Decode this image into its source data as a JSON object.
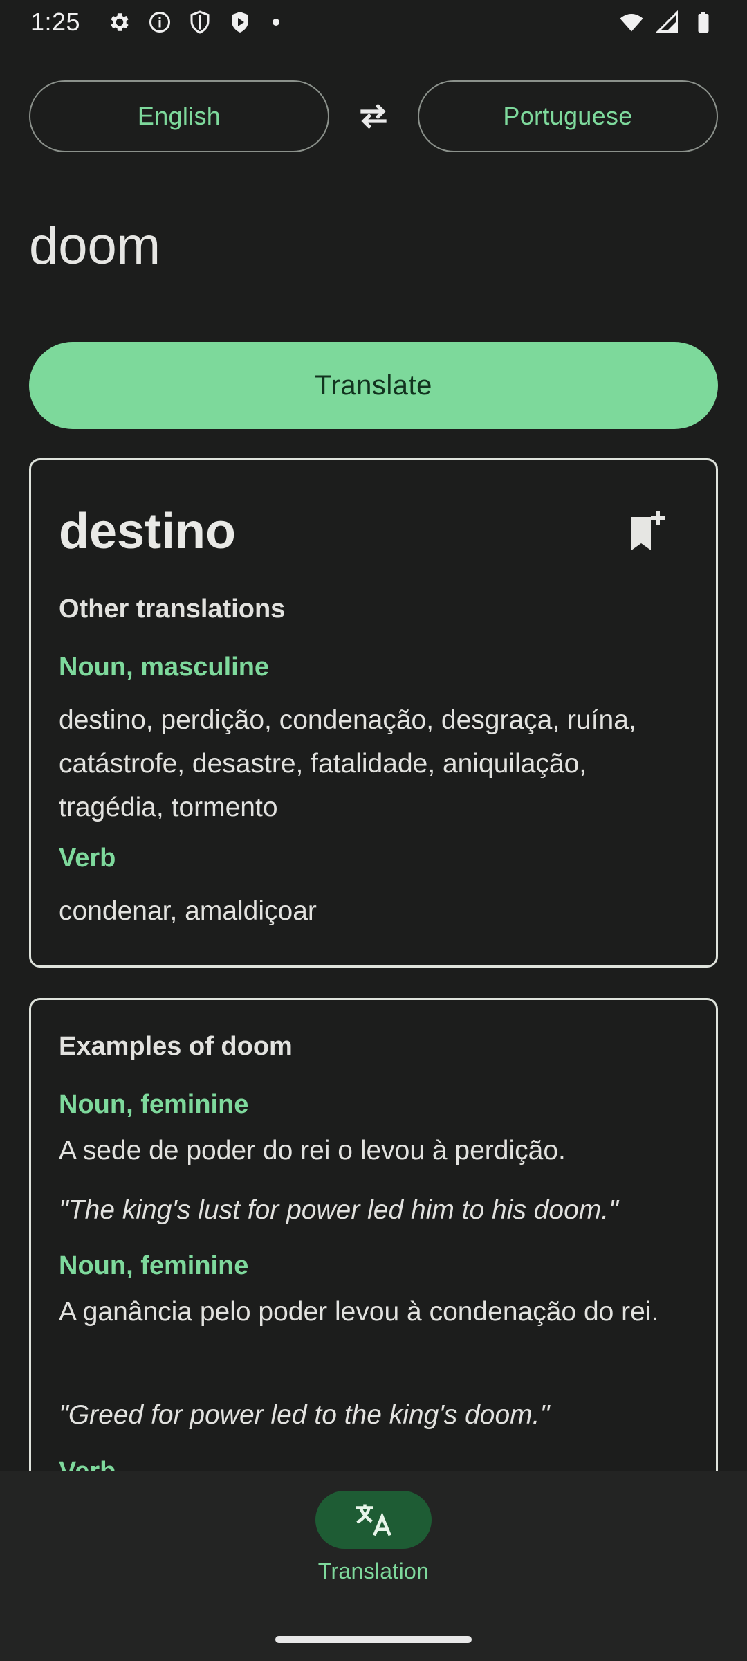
{
  "status_bar": {
    "time": "1:25",
    "left_icons": [
      "settings-icon",
      "info-icon",
      "shield-icon",
      "play-shield-icon",
      "dot-icon"
    ],
    "right_icons": [
      "wifi-icon",
      "signal-icon",
      "battery-icon"
    ]
  },
  "languages": {
    "source": "English",
    "target": "Portuguese",
    "swap_icon": "swap-arrows-icon"
  },
  "input": {
    "word": "doom"
  },
  "translate_button": {
    "label": "Translate"
  },
  "result": {
    "main_translation": "destino",
    "bookmark_icon": "bookmark-add-icon",
    "other_heading": "Other translations",
    "groups": [
      {
        "pos": "Noun, masculine",
        "words": "destino, perdição, condenação, desgraça, ruína, catástrofe, desastre, fatalidade, aniquilação, tragédia, tormento"
      },
      {
        "pos": "Verb",
        "words": "condenar, amaldiçoar"
      }
    ]
  },
  "examples": {
    "heading_prefix": "Examples of ",
    "heading_word": "doom",
    "items": [
      {
        "pos": "Noun, feminine",
        "source": "A sede de poder do rei o levou à perdição.",
        "english": "\"The king's lust for power led him to his doom.\""
      },
      {
        "pos": "Noun, feminine",
        "source": "A ganância pelo poder levou à condenação do rei.",
        "english": "\"Greed for power led to the king's doom.\""
      },
      {
        "pos": "Verb"
      }
    ]
  },
  "bottom_nav": {
    "items": [
      {
        "label": "Translation",
        "icon": "translate-icon",
        "selected": true
      }
    ]
  },
  "colors": {
    "background": "#1c1d1c",
    "accent": "#7dd99b",
    "accent_text": "#7ed99c",
    "nav_indicator": "#1e5c34",
    "card_border": "#dfe3dc"
  }
}
